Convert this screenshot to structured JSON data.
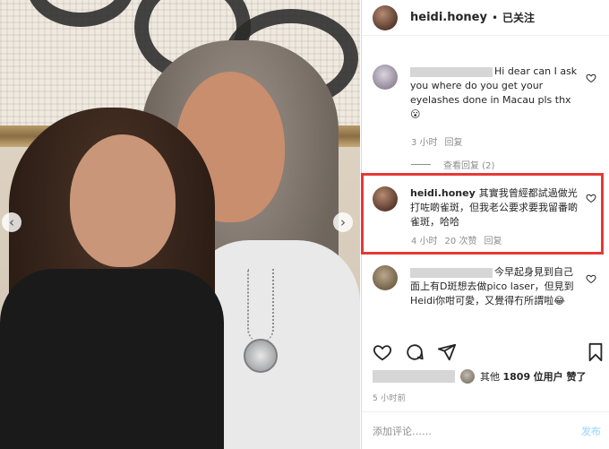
{
  "post": {
    "username": "heidi.honey",
    "separator": "•",
    "follow_status": "已关注"
  },
  "comments": [
    {
      "username": "",
      "text": "Hi dear can I ask you where do you get your eyelashes done in Macau pls thx 😮",
      "time": "3 小时",
      "likes": "",
      "reply": "回复",
      "view_replies": "查看回复 (2)"
    },
    {
      "username": "heidi.honey",
      "text": "其實我曾經都試過做光打咗啲雀斑，但我老公要求要我留番啲雀斑，哈哈",
      "time": "4 小时",
      "likes": "20 次赞",
      "reply": "回复"
    },
    {
      "username": "",
      "text": "今早起身見到自己面上有D斑想去做pico laser，但見到Heidi你咁可愛，又覺得冇所謂啦😂",
      "time": "",
      "likes": "",
      "reply": ""
    }
  ],
  "likes_line": {
    "prefix": "其他",
    "count": "1809",
    "suffix": "位用户 赞了"
  },
  "timestamp": "5 小时前",
  "add_comment": {
    "placeholder": "添加评论……",
    "post_label": "发布"
  },
  "icons": {
    "heart": "heart-icon",
    "comment": "comment-icon",
    "share": "share-icon",
    "save": "bookmark-icon",
    "prev": "chevron-left-icon",
    "next": "chevron-right-icon"
  },
  "colors": {
    "highlight_box": "#e53935",
    "post_button": "#b2dffc",
    "meta_text": "#8e8e8e"
  }
}
